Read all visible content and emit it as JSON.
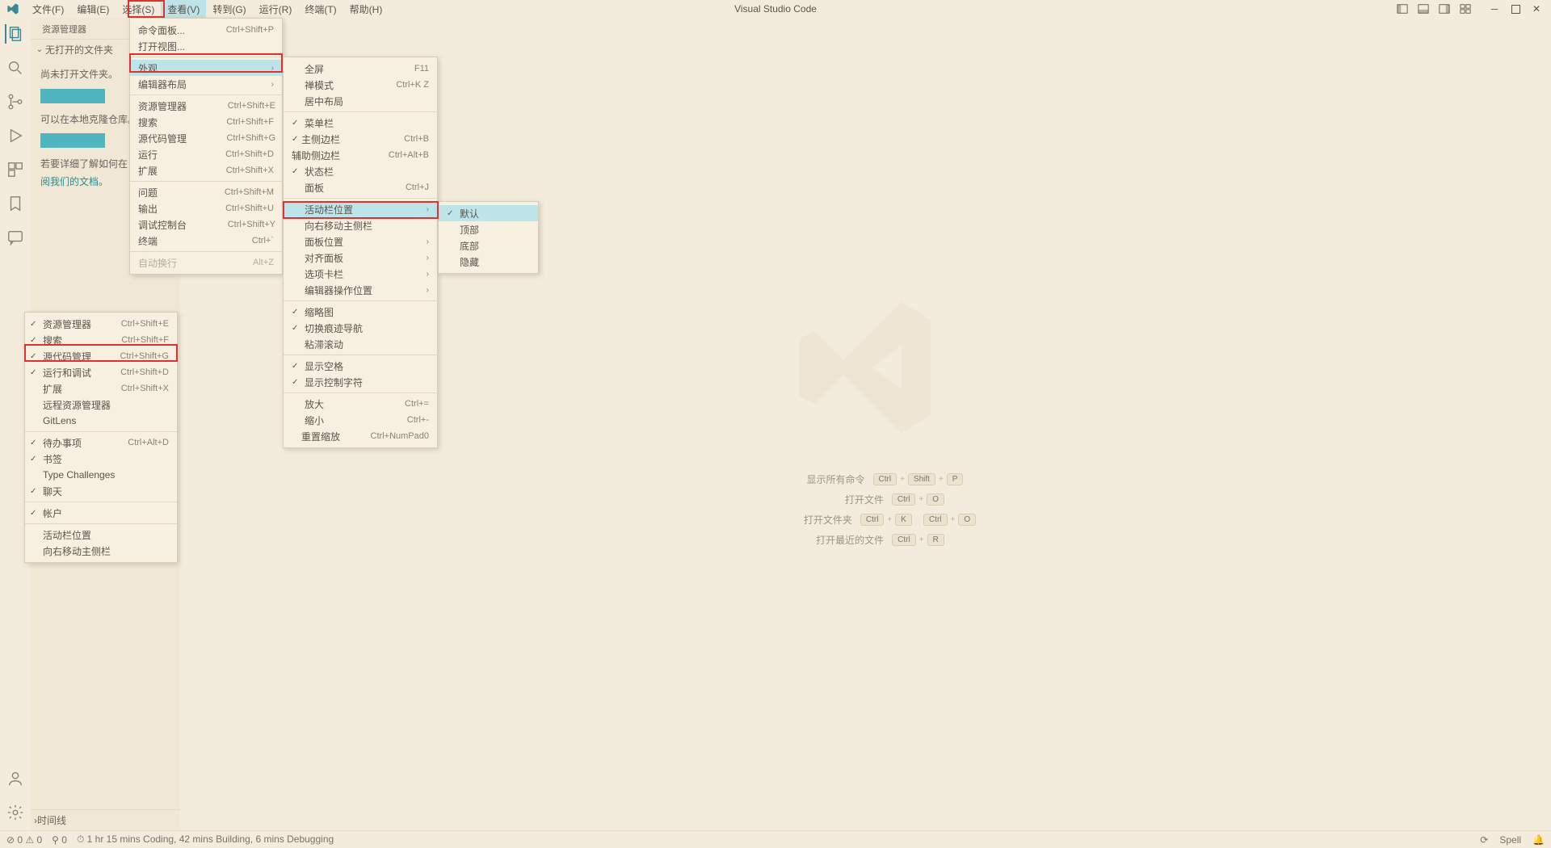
{
  "title": "Visual Studio Code",
  "menubar": [
    "文件(F)",
    "编辑(E)",
    "选择(S)",
    "查看(V)",
    "转到(G)",
    "运行(R)",
    "终端(T)",
    "帮助(H)"
  ],
  "menubar_active_index": 3,
  "sidebar": {
    "header": "资源管理器",
    "section": "无打开的文件夹",
    "line1": "尚未打开文件夹。",
    "line2": "可以在本地克隆仓库。",
    "line3_a": "若要详细了解如何在 VS",
    "link": "阅我们的文档",
    "timeline": "时间线"
  },
  "watermark": {
    "rows": [
      {
        "label": "显示所有命令",
        "keys": [
          "Ctrl",
          "Shift",
          "P"
        ]
      },
      {
        "label": "打开文件",
        "keys": [
          "Ctrl",
          "O"
        ]
      },
      {
        "label": "打开文件夹",
        "keys": [
          "Ctrl",
          "K",
          "Ctrl",
          "O"
        ],
        "split": 2
      },
      {
        "label": "打开最近的文件",
        "keys": [
          "Ctrl",
          "R"
        ]
      }
    ]
  },
  "status": {
    "left": [
      "⊘ 0 ⚠ 0",
      "⚲ 0",
      "⏱ 1 hr 15 mins Coding, 42 mins Building, 6 mins Debugging"
    ],
    "right": [
      "⟳",
      "Spell",
      "🔔"
    ]
  },
  "menu_view": [
    {
      "label": "命令面板...",
      "sc": "Ctrl+Shift+P"
    },
    {
      "label": "打开视图..."
    },
    {
      "sep": true
    },
    {
      "label": "外观",
      "sub": true,
      "sel": true
    },
    {
      "label": "编辑器布局",
      "sub": true
    },
    {
      "sep": true
    },
    {
      "label": "资源管理器",
      "sc": "Ctrl+Shift+E"
    },
    {
      "label": "搜索",
      "sc": "Ctrl+Shift+F"
    },
    {
      "label": "源代码管理",
      "sc": "Ctrl+Shift+G"
    },
    {
      "label": "运行",
      "sc": "Ctrl+Shift+D"
    },
    {
      "label": "扩展",
      "sc": "Ctrl+Shift+X"
    },
    {
      "sep": true
    },
    {
      "label": "问题",
      "sc": "Ctrl+Shift+M"
    },
    {
      "label": "输出",
      "sc": "Ctrl+Shift+U"
    },
    {
      "label": "调试控制台",
      "sc": "Ctrl+Shift+Y"
    },
    {
      "label": "终端",
      "sc": "Ctrl+`"
    },
    {
      "sep": true
    },
    {
      "label": "自动换行",
      "sc": "Alt+Z",
      "disabled": true
    }
  ],
  "menu_appear": [
    {
      "label": "全屏",
      "sc": "F11"
    },
    {
      "label": "禅模式",
      "sc": "Ctrl+K Z"
    },
    {
      "label": "居中布局"
    },
    {
      "sep": true
    },
    {
      "label": "菜单栏",
      "chk": true
    },
    {
      "label": "主侧边栏",
      "chk": true,
      "sc": "Ctrl+B"
    },
    {
      "label": "辅助侧边栏",
      "sc": "Ctrl+Alt+B"
    },
    {
      "label": "状态栏",
      "chk": true
    },
    {
      "label": "面板",
      "sc": "Ctrl+J"
    },
    {
      "sep": true
    },
    {
      "label": "活动栏位置",
      "sub": true,
      "sel": true
    },
    {
      "label": "向右移动主侧栏"
    },
    {
      "label": "面板位置",
      "sub": true
    },
    {
      "label": "对齐面板",
      "sub": true
    },
    {
      "label": "选项卡栏",
      "sub": true
    },
    {
      "label": "编辑器操作位置",
      "sub": true
    },
    {
      "sep": true
    },
    {
      "label": "缩略图",
      "chk": true
    },
    {
      "label": "切换痕迹导航",
      "chk": true
    },
    {
      "label": "粘滞滚动"
    },
    {
      "sep": true
    },
    {
      "label": "显示空格",
      "chk": true
    },
    {
      "label": "显示控制字符",
      "chk": true
    },
    {
      "sep": true
    },
    {
      "label": "放大",
      "sc": "Ctrl+="
    },
    {
      "label": "缩小",
      "sc": "Ctrl+-"
    },
    {
      "label": "重置缩放",
      "sc": "Ctrl+NumPad0"
    }
  ],
  "menu_pos": [
    {
      "label": "默认",
      "chk": true,
      "sel": true
    },
    {
      "label": "顶部"
    },
    {
      "label": "底部"
    },
    {
      "label": "隐藏"
    }
  ],
  "ctx": [
    {
      "label": "资源管理器",
      "chk": true,
      "sc": "Ctrl+Shift+E"
    },
    {
      "label": "搜索",
      "chk": true,
      "sc": "Ctrl+Shift+F"
    },
    {
      "label": "源代码管理",
      "chk": true,
      "sc": "Ctrl+Shift+G",
      "hl": true
    },
    {
      "label": "运行和调试",
      "chk": true,
      "sc": "Ctrl+Shift+D"
    },
    {
      "label": "扩展",
      "sc": "Ctrl+Shift+X"
    },
    {
      "label": "远程资源管理器"
    },
    {
      "label": "GitLens"
    },
    {
      "sep": true
    },
    {
      "label": "待办事项",
      "chk": true,
      "sc": "Ctrl+Alt+D"
    },
    {
      "label": "书签",
      "chk": true
    },
    {
      "label": "Type Challenges"
    },
    {
      "label": "聊天",
      "chk": true
    },
    {
      "sep": true
    },
    {
      "label": "帐户",
      "chk": true
    },
    {
      "sep": true
    },
    {
      "label": "活动栏位置"
    },
    {
      "label": "向右移动主侧栏"
    }
  ]
}
